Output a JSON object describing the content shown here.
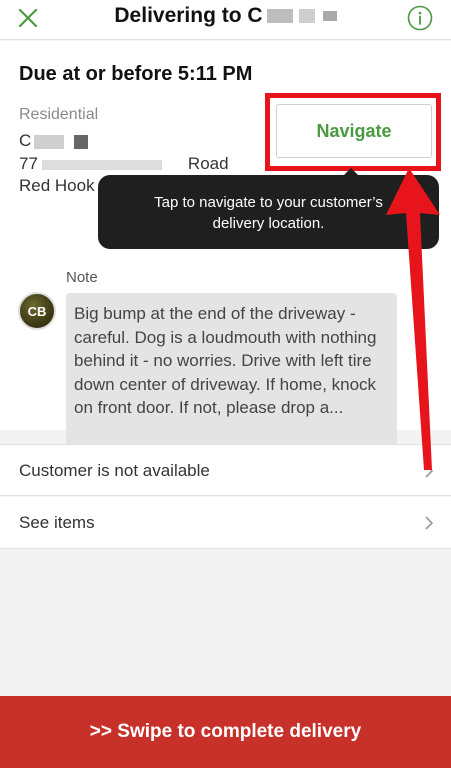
{
  "header": {
    "title": "Delivering to C",
    "close_icon": "close-icon",
    "info_icon": "info-icon"
  },
  "delivery": {
    "due": "Due at or before 5:11 PM",
    "address_type": "Residential",
    "address_line1": "C",
    "address_line2_prefix": "77",
    "address_line2_suffix": "Road",
    "address_line3": "Red Hook"
  },
  "navigate": {
    "label": "Navigate",
    "tooltip_line1": "Tap to navigate to your customer’s",
    "tooltip_line2": "delivery location."
  },
  "note": {
    "label": "Note",
    "avatar_initials": "CB",
    "text": "Big bump at the end of the driveway - careful. Dog is a loudmouth with nothing behind it - no worries. Drive with left tire down center of driveway. If home, knock on front door. If not, please drop a..."
  },
  "actions": {
    "customer_unavailable": "Customer is not available",
    "see_items": "See items"
  },
  "footer": {
    "swipe_label": ">> Swipe to complete delivery"
  },
  "colors": {
    "accent_green": "#4a9a3f",
    "swipe_red": "#c8302a",
    "highlight_red": "#e8141b",
    "tooltip_bg": "#1f1f1f"
  }
}
